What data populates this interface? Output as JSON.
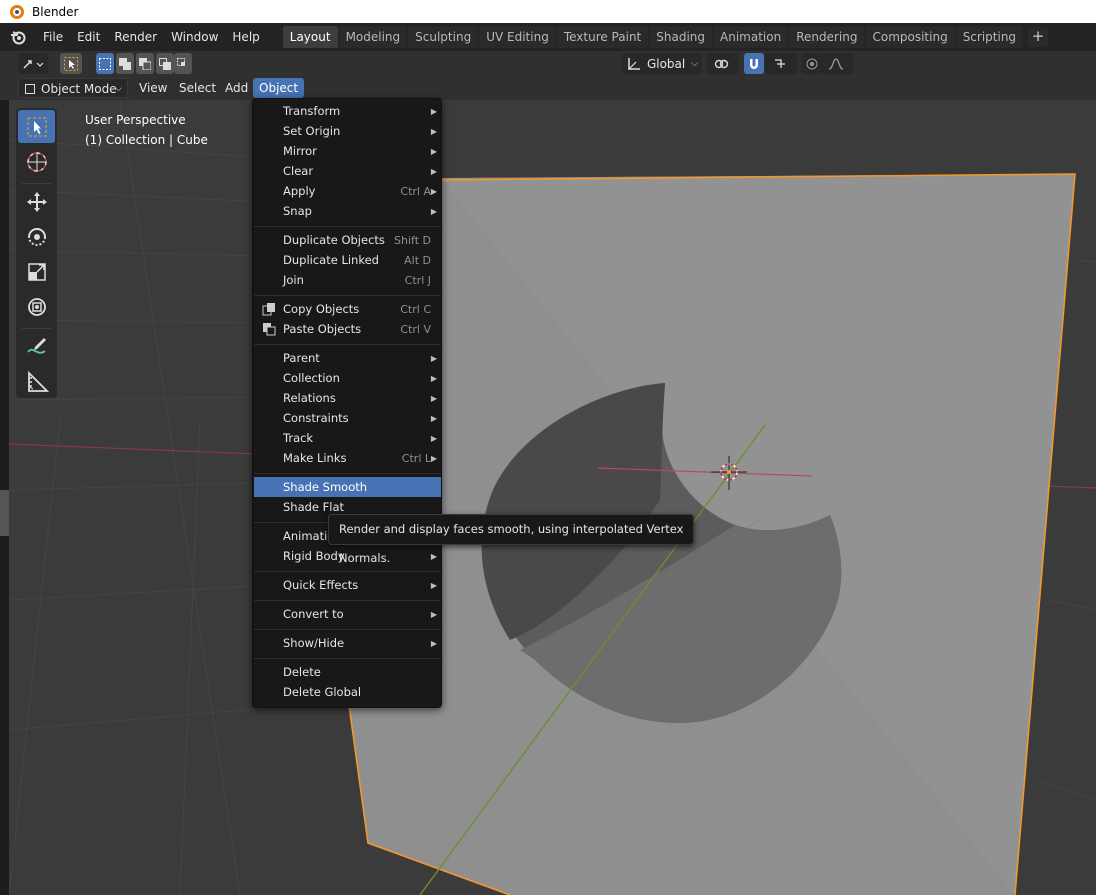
{
  "window": {
    "title": "Blender"
  },
  "menubar": {
    "items": [
      "File",
      "Edit",
      "Render",
      "Window",
      "Help"
    ]
  },
  "workspaces": {
    "tabs": [
      "Layout",
      "Modeling",
      "Sculpting",
      "UV Editing",
      "Texture Paint",
      "Shading",
      "Animation",
      "Rendering",
      "Compositing",
      "Scripting"
    ],
    "active": "Layout",
    "add_label": "+"
  },
  "tool_settings": {
    "transform_orientation": "Global"
  },
  "viewport_header": {
    "mode": "Object Mode",
    "menus": [
      "View",
      "Select",
      "Add",
      "Object"
    ],
    "active_menu": "Object"
  },
  "viewport": {
    "perspective": "User Perspective",
    "collection": "(1) Collection | Cube"
  },
  "object_menu": {
    "items": [
      {
        "label": "Transform",
        "submenu": true
      },
      {
        "label": "Set Origin",
        "submenu": true
      },
      {
        "label": "Mirror",
        "submenu": true
      },
      {
        "label": "Clear",
        "submenu": true
      },
      {
        "label": "Apply",
        "shortcut": "Ctrl A",
        "submenu": true
      },
      {
        "label": "Snap",
        "submenu": true
      },
      {
        "label": "Duplicate Objects",
        "shortcut": "Shift D"
      },
      {
        "label": "Duplicate Linked",
        "shortcut": "Alt D"
      },
      {
        "label": "Join",
        "shortcut": "Ctrl J"
      },
      {
        "label": "Copy Objects",
        "shortcut": "Ctrl C",
        "icon": "copy-icon"
      },
      {
        "label": "Paste Objects",
        "shortcut": "Ctrl V",
        "icon": "paste-icon"
      },
      {
        "label": "Parent",
        "submenu": true
      },
      {
        "label": "Collection",
        "submenu": true
      },
      {
        "label": "Relations",
        "submenu": true
      },
      {
        "label": "Constraints",
        "submenu": true
      },
      {
        "label": "Track",
        "submenu": true
      },
      {
        "label": "Make Links",
        "shortcut": "Ctrl L",
        "submenu": true
      },
      {
        "label": "Shade Smooth",
        "highlighted": true
      },
      {
        "label": "Shade Flat"
      },
      {
        "label": "Animation",
        "submenu": true
      },
      {
        "label": "Rigid Body",
        "submenu": true
      },
      {
        "label": "Quick Effects",
        "submenu": true
      },
      {
        "label": "Convert to",
        "submenu": true
      },
      {
        "label": "Show/Hide",
        "submenu": true
      },
      {
        "label": "Delete"
      },
      {
        "label": "Delete Global"
      }
    ]
  },
  "tooltip": {
    "text": "Render and display faces smooth, using interpolated Vertex Normals."
  },
  "colors": {
    "accent": "#4772b3",
    "selection_outline": "#f4962e",
    "x_axis": "#b34c56",
    "y_axis": "#7da33a"
  }
}
